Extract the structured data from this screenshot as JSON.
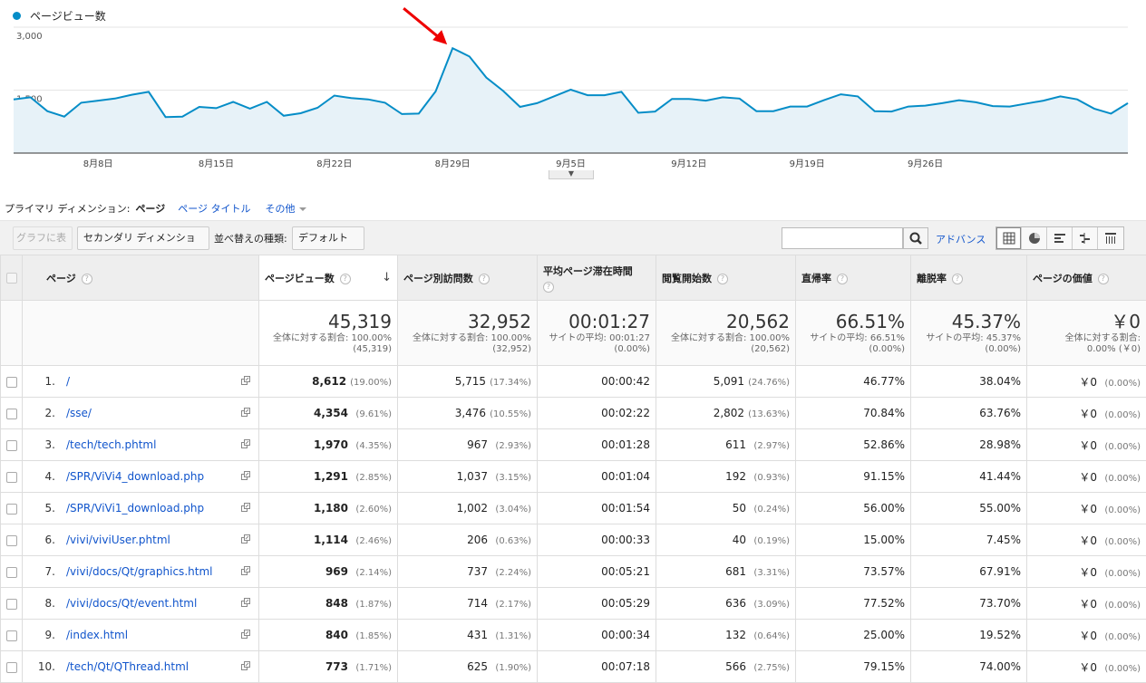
{
  "legend": {
    "label": "ページビュー数",
    "color": "#058dc7"
  },
  "chart_data": {
    "type": "area",
    "series": [
      {
        "name": "ページビュー数",
        "values": [
          1280,
          1330,
          1000,
          870,
          1200,
          1250,
          1300,
          1390,
          1460,
          860,
          870,
          1100,
          1070,
          1220,
          1060,
          1220,
          890,
          950,
          1080,
          1370,
          1310,
          1280,
          1200,
          930,
          940,
          1470,
          2500,
          2300,
          1800,
          1480,
          1100,
          1190,
          1350,
          1510,
          1380,
          1380,
          1460,
          960,
          990,
          1290,
          1290,
          1250,
          1330,
          1300,
          1000,
          1000,
          1110,
          1110,
          1260,
          1400,
          1350,
          1000,
          990,
          1110,
          1130,
          1190,
          1260,
          1210,
          1120,
          1110,
          1180,
          1250,
          1350,
          1280,
          1060,
          940,
          1190
        ]
      }
    ],
    "ylim": [
      0,
      3000
    ],
    "y_ticks": [
      "3,000",
      "1,500"
    ],
    "x_ticks": [
      "8月8日",
      "8月15日",
      "8月22日",
      "8月29日",
      "9月5日",
      "9月12日",
      "9月19日",
      "9月26日"
    ],
    "annotation": "red-arrow-at-peak",
    "grid": true
  },
  "primary_dimension": {
    "label": "プライマリ ディメンション:",
    "active": "ページ",
    "link1": "ページ タイトル",
    "link2": "その他"
  },
  "toolbar": {
    "graph_btn": "グラフに表示",
    "secondary_dim": "セカンダリ ディメンション",
    "sort_label": "並べ替えの種類:",
    "sort_value": "デフォルト",
    "search_placeholder": "",
    "advance": "アドバンス"
  },
  "headers": {
    "page": "ページ",
    "pageviews": "ページビュー数",
    "unique": "ページ別訪問数",
    "avgtime": "平均ページ滞在時間",
    "entrances": "閲覧開始数",
    "bounce": "直帰率",
    "exit": "離脱率",
    "value": "ページの価値",
    "help": "?"
  },
  "totals": {
    "pageviews": {
      "big": "45,319",
      "l1": "全体に対する割合: 100.00%",
      "l2": "(45,319)"
    },
    "unique": {
      "big": "32,952",
      "l1": "全体に対する割合: 100.00%",
      "l2": "(32,952)"
    },
    "avgtime": {
      "big": "00:01:27",
      "l1": "サイトの平均: 00:01:27",
      "l2": "(0.00%)"
    },
    "entrances": {
      "big": "20,562",
      "l1": "全体に対する割合: 100.00%",
      "l2": "(20,562)"
    },
    "bounce": {
      "big": "66.51%",
      "l1": "サイトの平均: 66.51%",
      "l2": "(0.00%)"
    },
    "exit": {
      "big": "45.37%",
      "l1": "サイトの平均: 45.37%",
      "l2": "(0.00%)"
    },
    "value": {
      "big": "￥0",
      "l1": "全体に対する割合:",
      "l2": "0.00% (￥0)"
    }
  },
  "rows": [
    {
      "n": "1.",
      "page": "/",
      "pv": "8,612",
      "pvp": "(19.00%)",
      "u": "5,715",
      "up": "(17.34%)",
      "t": "00:00:42",
      "e": "5,091",
      "ep": "(24.76%)",
      "b": "46.77%",
      "x": "38.04%",
      "v": "￥0",
      "vp": "(0.00%)"
    },
    {
      "n": "2.",
      "page": "/sse/",
      "pv": "4,354",
      "pvp": "(9.61%)",
      "u": "3,476",
      "up": "(10.55%)",
      "t": "00:02:22",
      "e": "2,802",
      "ep": "(13.63%)",
      "b": "70.84%",
      "x": "63.76%",
      "v": "￥0",
      "vp": "(0.00%)"
    },
    {
      "n": "3.",
      "page": "/tech/tech.phtml",
      "pv": "1,970",
      "pvp": "(4.35%)",
      "u": "967",
      "up": "(2.93%)",
      "t": "00:01:28",
      "e": "611",
      "ep": "(2.97%)",
      "b": "52.86%",
      "x": "28.98%",
      "v": "￥0",
      "vp": "(0.00%)"
    },
    {
      "n": "4.",
      "page": "/SPR/ViVi4_download.php",
      "pv": "1,291",
      "pvp": "(2.85%)",
      "u": "1,037",
      "up": "(3.15%)",
      "t": "00:01:04",
      "e": "192",
      "ep": "(0.93%)",
      "b": "91.15%",
      "x": "41.44%",
      "v": "￥0",
      "vp": "(0.00%)"
    },
    {
      "n": "5.",
      "page": "/SPR/ViVi1_download.php",
      "pv": "1,180",
      "pvp": "(2.60%)",
      "u": "1,002",
      "up": "(3.04%)",
      "t": "00:01:54",
      "e": "50",
      "ep": "(0.24%)",
      "b": "56.00%",
      "x": "55.00%",
      "v": "￥0",
      "vp": "(0.00%)"
    },
    {
      "n": "6.",
      "page": "/vivi/viviUser.phtml",
      "pv": "1,114",
      "pvp": "(2.46%)",
      "u": "206",
      "up": "(0.63%)",
      "t": "00:00:33",
      "e": "40",
      "ep": "(0.19%)",
      "b": "15.00%",
      "x": "7.45%",
      "v": "￥0",
      "vp": "(0.00%)"
    },
    {
      "n": "7.",
      "page": "/vivi/docs/Qt/graphics.html",
      "pv": "969",
      "pvp": "(2.14%)",
      "u": "737",
      "up": "(2.24%)",
      "t": "00:05:21",
      "e": "681",
      "ep": "(3.31%)",
      "b": "73.57%",
      "x": "67.91%",
      "v": "￥0",
      "vp": "(0.00%)"
    },
    {
      "n": "8.",
      "page": "/vivi/docs/Qt/event.html",
      "pv": "848",
      "pvp": "(1.87%)",
      "u": "714",
      "up": "(2.17%)",
      "t": "00:05:29",
      "e": "636",
      "ep": "(3.09%)",
      "b": "77.52%",
      "x": "73.70%",
      "v": "￥0",
      "vp": "(0.00%)"
    },
    {
      "n": "9.",
      "page": "/index.html",
      "pv": "840",
      "pvp": "(1.85%)",
      "u": "431",
      "up": "(1.31%)",
      "t": "00:00:34",
      "e": "132",
      "ep": "(0.64%)",
      "b": "25.00%",
      "x": "19.52%",
      "v": "￥0",
      "vp": "(0.00%)"
    },
    {
      "n": "10.",
      "page": "/tech/Qt/QThread.html",
      "pv": "773",
      "pvp": "(1.71%)",
      "u": "625",
      "up": "(1.90%)",
      "t": "00:07:18",
      "e": "566",
      "ep": "(2.75%)",
      "b": "79.15%",
      "x": "74.00%",
      "v": "￥0",
      "vp": "(0.00%)"
    }
  ]
}
